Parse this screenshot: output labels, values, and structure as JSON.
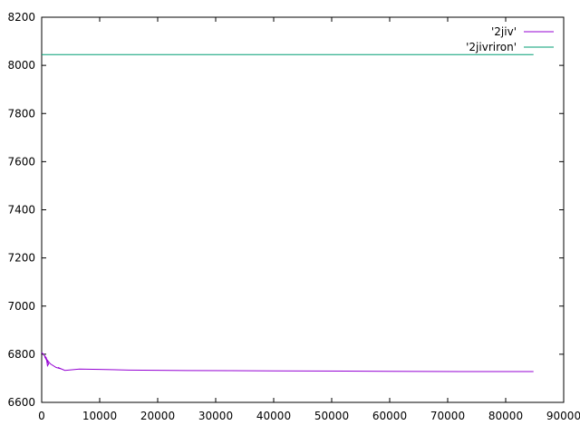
{
  "chart_data": {
    "type": "line",
    "title": "",
    "xlabel": "",
    "ylabel": "",
    "xlim": [
      0,
      90000
    ],
    "ylim": [
      6600,
      8200
    ],
    "x_ticks": [
      0,
      10000,
      20000,
      30000,
      40000,
      50000,
      60000,
      70000,
      80000,
      90000
    ],
    "y_ticks": [
      6600,
      6800,
      7000,
      7200,
      7400,
      7600,
      7800,
      8000,
      8200
    ],
    "grid": false,
    "legend_position": "top-right",
    "series": [
      {
        "name": "'2jiv'",
        "color": "#9400d3",
        "x": [
          0,
          800,
          1000,
          1200,
          500,
          1500,
          2500,
          3500,
          2800,
          4000,
          6500,
          10000,
          15000,
          25000,
          40000,
          60000,
          75000,
          84800
        ],
        "y": [
          6808,
          6785,
          6752,
          6760,
          6790,
          6760,
          6745,
          6738,
          6745,
          6733,
          6738,
          6737,
          6734,
          6732,
          6731,
          6729,
          6728,
          6728
        ]
      },
      {
        "name": "'2jivriron'",
        "color": "#009e73",
        "x": [
          0,
          84800
        ],
        "y": [
          8045,
          8045
        ]
      }
    ]
  }
}
